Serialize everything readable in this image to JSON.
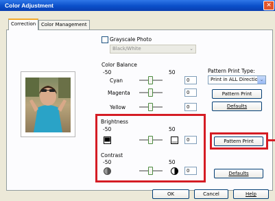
{
  "window": {
    "title": "Color Adjustment",
    "close_icon": "close-icon"
  },
  "tabs": [
    {
      "label": "Correction",
      "active": true
    },
    {
      "label": "Color Management",
      "active": false
    }
  ],
  "grayscale": {
    "label": "Grayscale Photo",
    "checked": false
  },
  "mode_select": {
    "value": "Black/White",
    "disabled": true
  },
  "color_balance": {
    "label": "Color Balance",
    "min": "-50",
    "max": "50",
    "rows": [
      {
        "label": "Cyan",
        "value": "0"
      },
      {
        "label": "Magenta",
        "value": "0"
      },
      {
        "label": "Yellow",
        "value": "0"
      }
    ]
  },
  "pattern_print_type": {
    "label": "Pattern Print Type:",
    "value": "Print in ALL Directio..."
  },
  "buttons": {
    "pattern_print_top": "Pattern Print",
    "defaults_top": "Defaults",
    "pattern_print_bottom": "Pattern Print",
    "defaults_bottom": "Defaults",
    "ok": "OK",
    "cancel": "Cancel",
    "help": "Help"
  },
  "brightness": {
    "label": "Brightness",
    "min": "-50",
    "max": "50",
    "value": "0"
  },
  "contrast": {
    "label": "Contrast",
    "min": "-50",
    "max": "50",
    "value": "0"
  },
  "colors": {
    "highlight": "#d51c24",
    "titlebar": "#0a4fc9"
  }
}
